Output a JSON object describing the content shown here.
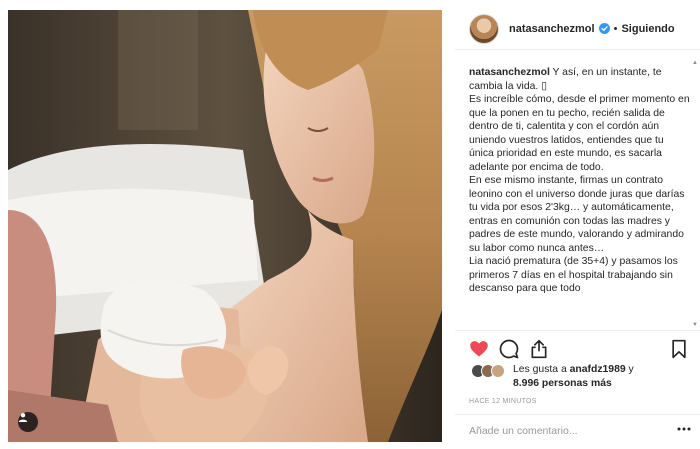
{
  "post": {
    "username": "natasanchezmol",
    "separator": "•",
    "follow_status": "Siguiendo",
    "caption": {
      "username": "natasanchezmol",
      "paragraphs": [
        " Y así, en un instante, te cambia la vida. ▯",
        "Es increíble cómo, desde el primer momento en que la ponen en tu pecho, recién salida de dentro de ti, calentita y con el cordón aún uniendo vuestros latidos, entiendes que tu única prioridad en este mundo, es sacarla adelante por encima de todo.",
        "En ese mismo instante, firmas un contrato leonino con el universo donde juras que darías tu vida por esos 2'3kg… y automáticamente, entras en comunión con todas las madres y padres de este mundo, valorando y admirando su labor como nunca antes…",
        "Lia nació prematura (de 35+4) y pasamos los primeros 7 días en el hospital trabajando sin descanso para que todo"
      ]
    },
    "likes": {
      "prefix": "Les gusta a ",
      "first_user": "anafdz1989",
      "connector": " y",
      "count_text": "8.996 personas más"
    },
    "timestamp": "HACE 12 MINUTOS",
    "comment_placeholder": "Añade un comentario...",
    "colors": {
      "like_red": "#ed4956",
      "verified_blue": "#3897f0",
      "text": "#262626",
      "muted": "#999999"
    },
    "icons": {
      "like": "heart-filled-icon",
      "comment": "speech-bubble-icon",
      "share": "share-arrow-icon",
      "save": "bookmark-icon",
      "verified": "verified-badge-icon",
      "tag": "user-tag-icon",
      "more": "ellipsis-icon"
    }
  }
}
